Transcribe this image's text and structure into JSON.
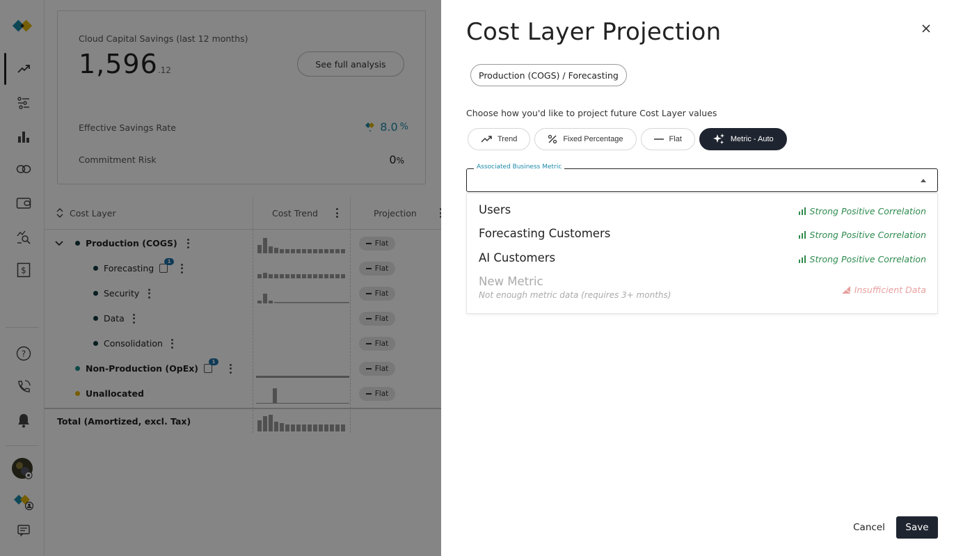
{
  "sidebar": {
    "icons": [
      "logo-icon",
      "trend-icon",
      "filter-icon",
      "bar-chart-icon",
      "link-icon",
      "wallet-icon",
      "search-chart-icon",
      "dollar-doc-icon",
      "help-icon",
      "phone-icon",
      "bell-icon",
      "avatar",
      "org-icon",
      "chat-icon"
    ]
  },
  "savings": {
    "title": "Cloud Capital Savings (last 12 months)",
    "value": "1,596",
    "cents": ".12",
    "see_analysis": "See full analysis",
    "rate_label": "Effective Savings Rate",
    "rate_value": "8.0",
    "rate_pct": "%",
    "risk_label": "Commitment Risk",
    "risk_value": "0",
    "risk_pct": "%"
  },
  "table": {
    "headers": {
      "cost_layer": "Cost Layer",
      "cost_trend": "Cost Trend",
      "projection": "Projection"
    },
    "rows": [
      {
        "name": "Production (COGS)",
        "projection": "Flat"
      },
      {
        "name": "Forecasting",
        "projection": "Flat",
        "badge": "1"
      },
      {
        "name": "Security",
        "projection": "Flat"
      },
      {
        "name": "Data",
        "projection": "Flat"
      },
      {
        "name": "Consolidation",
        "projection": "Flat"
      },
      {
        "name": "Non-Production (OpEx)",
        "projection": "Flat",
        "badge": "1"
      },
      {
        "name": "Unallocated",
        "projection": "Flat"
      }
    ],
    "total": "Total (Amortized, excl. Tax)"
  },
  "drawer": {
    "title": "Cost Layer Projection",
    "breadcrumb": "Production (COGS) / Forecasting",
    "prompt": "Choose how you'd like to project future Cost Layer values",
    "methods": [
      "Trend",
      "Fixed Percentage",
      "Flat",
      "Metric - Auto"
    ],
    "active_method": "Metric - Auto",
    "field_label": "Associated Business Metric",
    "field_value": "",
    "options": [
      {
        "label": "Users",
        "correlation": "Strong Positive Correlation"
      },
      {
        "label": "Forecasting Customers",
        "correlation": "Strong Positive Correlation"
      },
      {
        "label": "AI Customers",
        "correlation": "Strong Positive Correlation"
      },
      {
        "label": "New Metric",
        "sub": "Not enough metric data (requires 3+ months)",
        "correlation": "Insufficient Data"
      }
    ],
    "cancel": "Cancel",
    "save": "Save"
  },
  "colors": {
    "primary_dark": "#1f2530",
    "accent_teal": "#1c8aa8",
    "correlation_green": "#2e8a4e",
    "insufficient_red": "#e8a0a0",
    "dot_dark": "#123a40",
    "dot_teal": "#1f8a8a",
    "dot_gold": "#e0b400"
  }
}
